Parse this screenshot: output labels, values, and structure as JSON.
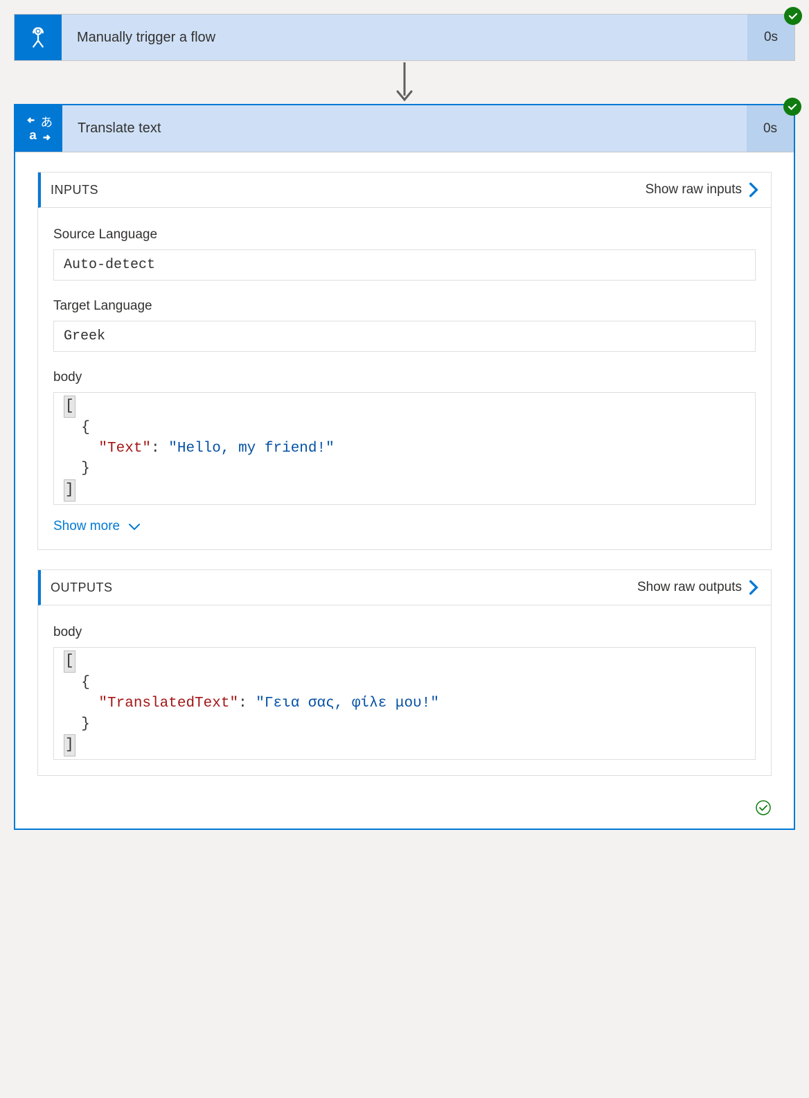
{
  "trigger": {
    "title": "Manually trigger a flow",
    "duration": "0s"
  },
  "action": {
    "title": "Translate text",
    "duration": "0s"
  },
  "inputs": {
    "section_title": "INPUTS",
    "raw_link": "Show raw inputs",
    "fields": {
      "source_language": {
        "label": "Source Language",
        "value": "Auto-detect"
      },
      "target_language": {
        "label": "Target Language",
        "value": "Greek"
      },
      "body": {
        "label": "body"
      }
    },
    "body_json": {
      "key": "\"Text\"",
      "value": "\"Hello, my friend!\""
    },
    "show_more": "Show more"
  },
  "outputs": {
    "section_title": "OUTPUTS",
    "raw_link": "Show raw outputs",
    "body_label": "body",
    "body_json": {
      "key": "\"TranslatedText\"",
      "value": "\"Γεια σας, φίλε μου!\""
    }
  }
}
